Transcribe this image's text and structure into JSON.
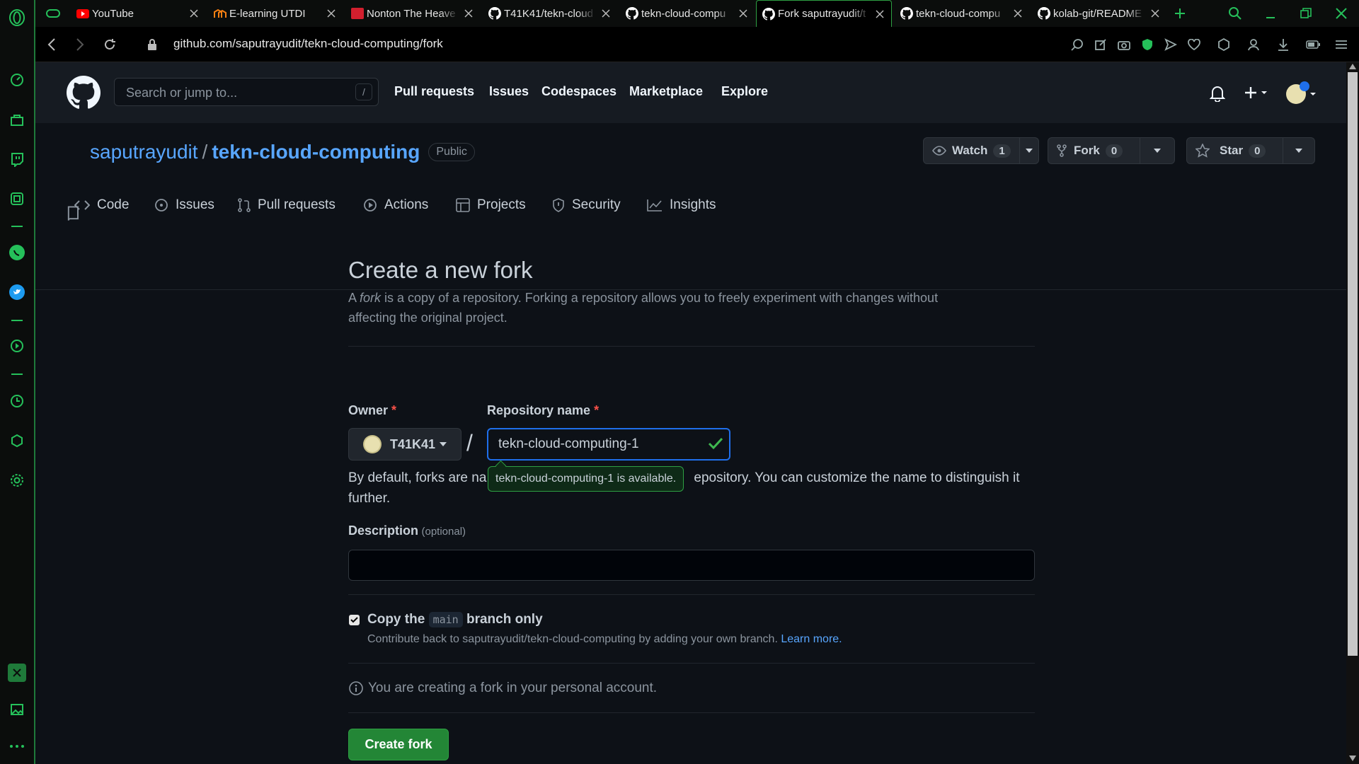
{
  "browser": {
    "tabs": [
      {
        "label": "YouTube",
        "favicon": "youtube-icon"
      },
      {
        "label": "E-learning UTDI",
        "favicon": "moodle-icon"
      },
      {
        "label": "Nonton The Heave",
        "favicon": "red-square-icon"
      },
      {
        "label": "T41K41/tekn-cloud",
        "favicon": "github-icon"
      },
      {
        "label": "tekn-cloud-compu",
        "favicon": "github-icon"
      },
      {
        "label": "Fork saputrayudit/t",
        "favicon": "github-icon",
        "active": true
      },
      {
        "label": "tekn-cloud-compu",
        "favicon": "github-icon"
      },
      {
        "label": "kolab-git/README",
        "favicon": "github-icon"
      }
    ],
    "url": "github.com/saputrayudit/tekn-cloud-computing/fork",
    "accent_color": "#25c05a"
  },
  "github": {
    "search_placeholder": "Search or jump to...",
    "search_shortcut": "/",
    "nav": [
      "Pull requests",
      "Issues",
      "Codespaces",
      "Marketplace",
      "Explore"
    ],
    "repo": {
      "owner": "saputrayudit",
      "name": "tekn-cloud-computing",
      "visibility": "Public",
      "watch_label": "Watch",
      "watch_count": "1",
      "fork_label": "Fork",
      "fork_count": "0",
      "star_label": "Star",
      "star_count": "0"
    },
    "tabs": [
      "Code",
      "Issues",
      "Pull requests",
      "Actions",
      "Projects",
      "Security",
      "Insights"
    ]
  },
  "form": {
    "title": "Create a new fork",
    "desc_prefix": "A ",
    "desc_em": "fork",
    "desc_suffix": " is a copy of a repository. Forking a repository allows you to freely experiment with changes without affecting the original project.",
    "owner_label": "Owner",
    "owner_value": "T41K41",
    "reponame_label": "Repository name",
    "reponame_value": "tekn-cloud-computing-1",
    "tooltip": "tekn-cloud-computing-1 is available.",
    "default_text_start": "By default, forks are na",
    "default_text_end": "epository. You can customize the name to distinguish it further.",
    "description_label": "Description",
    "description_optional": "(optional)",
    "copy_prefix": "Copy the",
    "copy_branch": "main",
    "copy_suffix": "branch only",
    "copy_help": "Contribute back to saputrayudit/tekn-cloud-computing by adding your own branch.",
    "learn_more": "Learn more.",
    "info": "You are creating a fork in your personal account.",
    "create_button": "Create fork",
    "required_mark": "*"
  }
}
